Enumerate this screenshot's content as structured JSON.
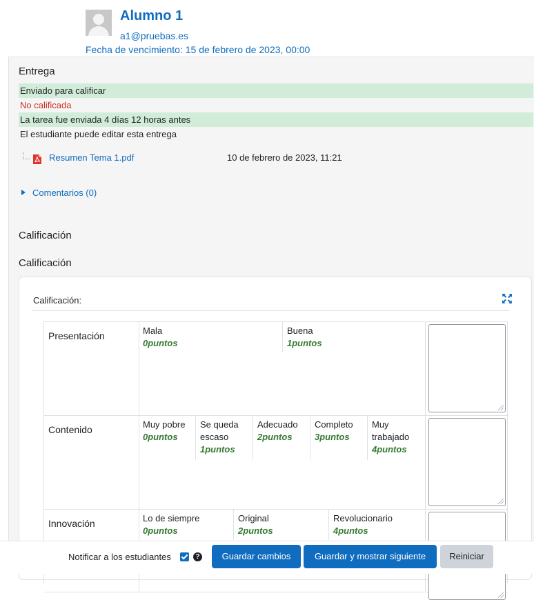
{
  "user": {
    "name": "Alumno 1",
    "email": "a1@pruebas.es",
    "due_date": "Fecha de vencimiento: 15 de febrero de 2023, 00:00"
  },
  "submission": {
    "heading": "Entrega",
    "status_lines": [
      "Enviado para calificar",
      "No calificada",
      "La tarea fue enviada 4 días 12 horas antes",
      "El estudiante puede editar esta entrega"
    ],
    "file": {
      "name": "Resumen Tema 1.pdf",
      "date": "10 de febrero de 2023, 11:21",
      "icon": "pdf-icon"
    },
    "comments_label": "Comentarios (0)"
  },
  "grading": {
    "heading_1": "Calificación",
    "heading_2": "Calificación",
    "card_label": "Calificación:",
    "rubric": [
      {
        "criterion": "Presentación",
        "levels": [
          {
            "definition": "Mala",
            "points": "0puntos"
          },
          {
            "definition": "Buena",
            "points": "1puntos"
          }
        ]
      },
      {
        "criterion": "Contenido",
        "levels": [
          {
            "definition": "Muy pobre",
            "points": "0puntos"
          },
          {
            "definition": "Se queda escaso",
            "points": "1puntos"
          },
          {
            "definition": "Adecuado",
            "points": "2puntos"
          },
          {
            "definition": "Completo",
            "points": "3puntos"
          },
          {
            "definition": "Muy trabajado",
            "points": "4puntos"
          }
        ]
      },
      {
        "criterion": "Innovación",
        "levels": [
          {
            "definition": "Lo de siempre",
            "points": "0puntos"
          },
          {
            "definition": "Original",
            "points": "2puntos"
          },
          {
            "definition": "Revolucionario",
            "points": "4puntos"
          }
        ]
      }
    ]
  },
  "footer": {
    "notify_label": "Notificar a los estudiantes",
    "notify_checked": true,
    "save_label": "Guardar cambios",
    "save_next_label": "Guardar y mostrar siguiente",
    "reset_label": "Reiniciar"
  },
  "colors": {
    "link": "#0f6cbf",
    "status_green": "#d1ecd8",
    "status_red": "#ca3120",
    "points_green": "#357a32"
  }
}
